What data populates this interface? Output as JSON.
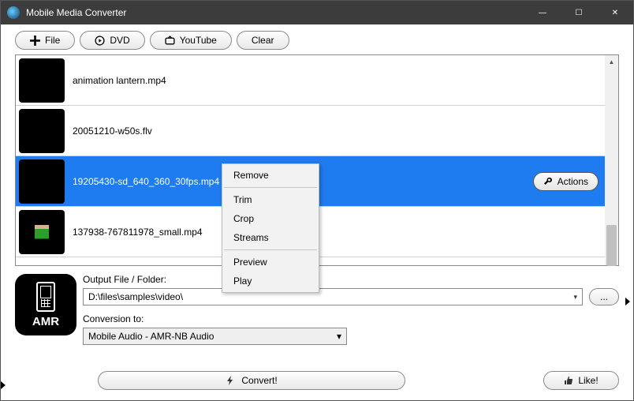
{
  "title": "Mobile Media Converter",
  "toolbar": {
    "file": "File",
    "dvd": "DVD",
    "youtube": "YouTube",
    "clear": "Clear"
  },
  "files": [
    {
      "name": "animation lantern.mp4",
      "selected": false
    },
    {
      "name": "20051210-w50s.flv",
      "selected": false
    },
    {
      "name": "19205430-sd_640_360_30fps.mp4",
      "selected": true
    },
    {
      "name": "137938-767811978_small.mp4",
      "selected": false
    }
  ],
  "actions_button": "Actions",
  "context_menu": {
    "items": [
      "Remove",
      "Trim",
      "Crop",
      "Streams",
      "Preview",
      "Play"
    ]
  },
  "output": {
    "label": "Output File / Folder:",
    "path": "D:\\files\\samples\\video\\",
    "browse": "..."
  },
  "conversion": {
    "label": "Conversion to:",
    "value": "Mobile Audio - AMR-NB Audio"
  },
  "amr_badge": "AMR",
  "footer": {
    "convert": "Convert!",
    "like": "Like!"
  },
  "win": {
    "min": "—",
    "max": "☐",
    "close": "✕"
  }
}
